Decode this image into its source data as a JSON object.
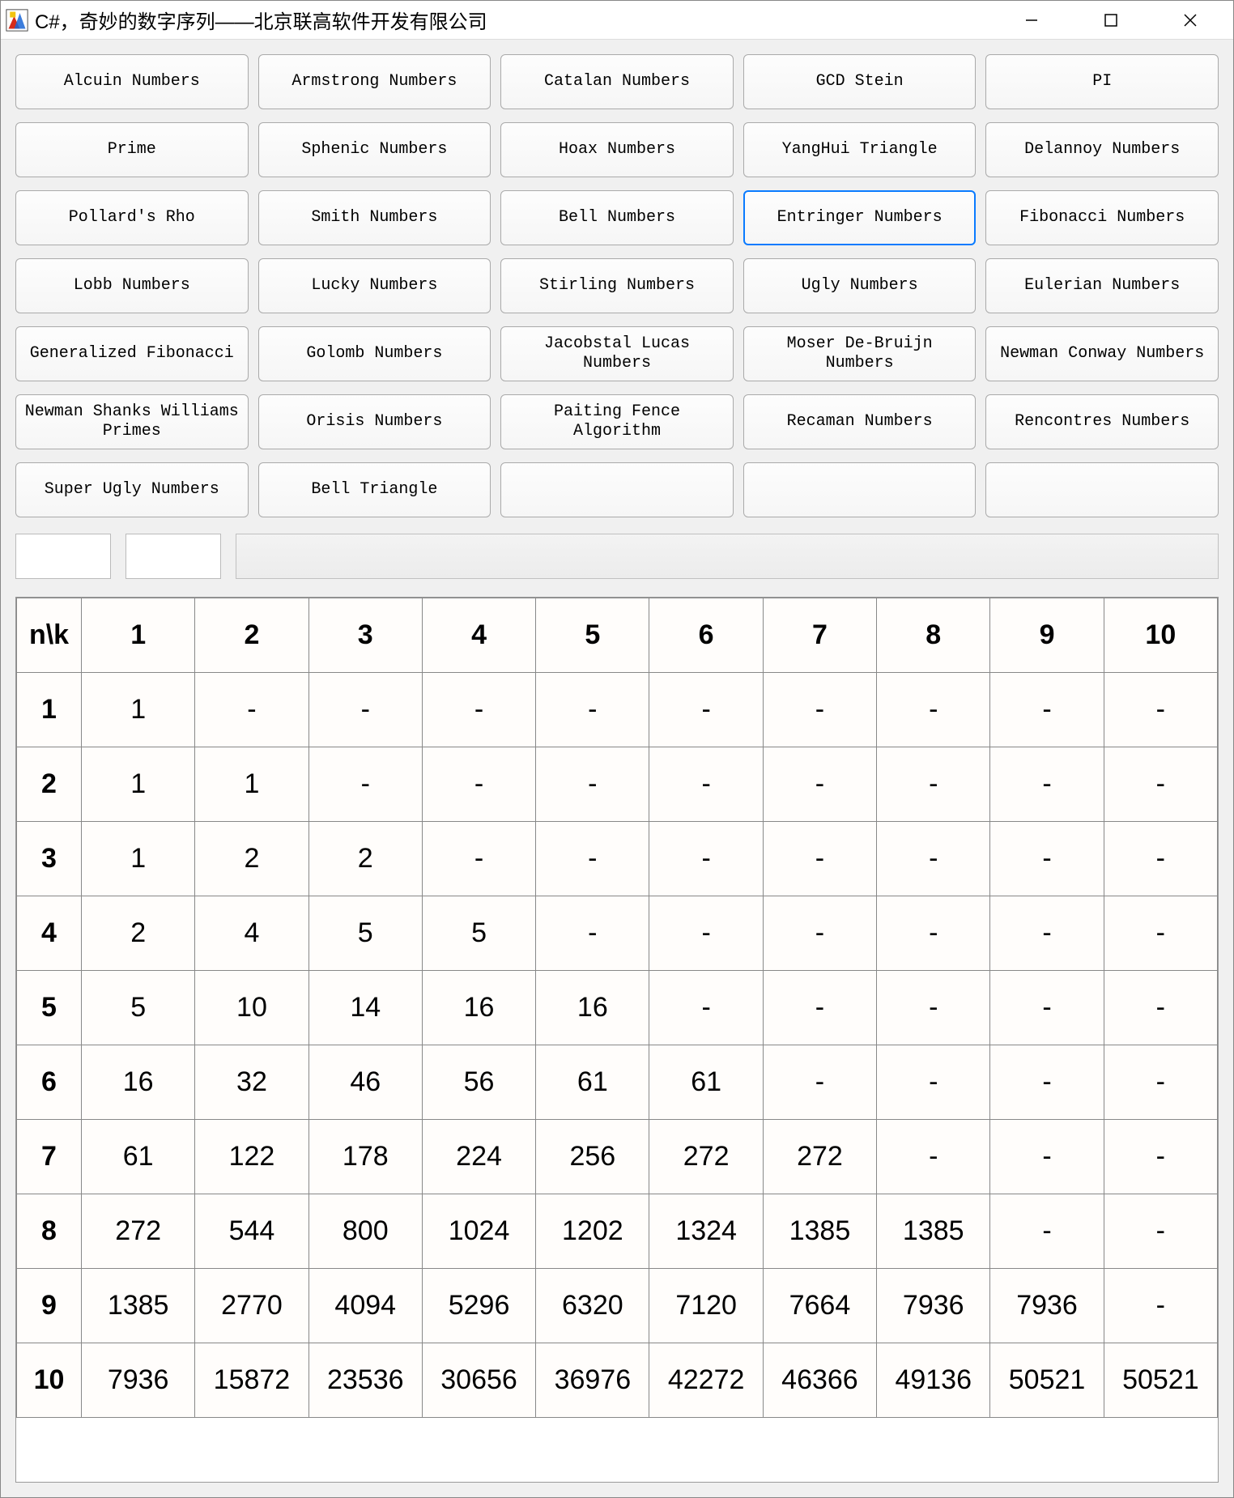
{
  "window": {
    "title": "C#，奇妙的数字序列——北京联高软件开发有限公司"
  },
  "buttons": [
    {
      "label": "Alcuin Numbers",
      "highlight": false
    },
    {
      "label": "Armstrong Numbers",
      "highlight": false
    },
    {
      "label": "Catalan Numbers",
      "highlight": false
    },
    {
      "label": "GCD Stein",
      "highlight": false
    },
    {
      "label": "PI",
      "highlight": false
    },
    {
      "label": "Prime",
      "highlight": false
    },
    {
      "label": "Sphenic Numbers",
      "highlight": false
    },
    {
      "label": "Hoax Numbers",
      "highlight": false
    },
    {
      "label": "YangHui Triangle",
      "highlight": false
    },
    {
      "label": "Delannoy Numbers",
      "highlight": false
    },
    {
      "label": "Pollard's Rho",
      "highlight": false
    },
    {
      "label": "Smith Numbers",
      "highlight": false
    },
    {
      "label": "Bell Numbers",
      "highlight": false
    },
    {
      "label": "Entringer Numbers",
      "highlight": true
    },
    {
      "label": "Fibonacci Numbers",
      "highlight": false
    },
    {
      "label": "Lobb Numbers",
      "highlight": false
    },
    {
      "label": "Lucky Numbers",
      "highlight": false
    },
    {
      "label": "Stirling Numbers",
      "highlight": false
    },
    {
      "label": "Ugly Numbers",
      "highlight": false
    },
    {
      "label": "Eulerian Numbers",
      "highlight": false
    },
    {
      "label": "Generalized Fibonacci",
      "highlight": false
    },
    {
      "label": "Golomb Numbers",
      "highlight": false
    },
    {
      "label": "Jacobstal Lucas Numbers",
      "highlight": false
    },
    {
      "label": "Moser De-Bruijn Numbers",
      "highlight": false
    },
    {
      "label": "Newman Conway Numbers",
      "highlight": false
    },
    {
      "label": "Newman Shanks Williams Primes",
      "highlight": false
    },
    {
      "label": "Orisis Numbers",
      "highlight": false
    },
    {
      "label": "Paiting Fence Algorithm",
      "highlight": false
    },
    {
      "label": "Recaman Numbers",
      "highlight": false
    },
    {
      "label": "Rencontres Numbers",
      "highlight": false
    },
    {
      "label": "Super Ugly Numbers",
      "highlight": false
    },
    {
      "label": "Bell Triangle",
      "highlight": false
    },
    {
      "label": "",
      "highlight": false
    },
    {
      "label": "",
      "highlight": false
    },
    {
      "label": "",
      "highlight": false
    }
  ],
  "chart_data": {
    "type": "table",
    "corner": "n\\k",
    "columns": [
      "1",
      "2",
      "3",
      "4",
      "5",
      "6",
      "7",
      "8",
      "9",
      "10"
    ],
    "rows": [
      {
        "n": "1",
        "cells": [
          "1",
          "-",
          "-",
          "-",
          "-",
          "-",
          "-",
          "-",
          "-",
          "-"
        ]
      },
      {
        "n": "2",
        "cells": [
          "1",
          "1",
          "-",
          "-",
          "-",
          "-",
          "-",
          "-",
          "-",
          "-"
        ]
      },
      {
        "n": "3",
        "cells": [
          "1",
          "2",
          "2",
          "-",
          "-",
          "-",
          "-",
          "-",
          "-",
          "-"
        ]
      },
      {
        "n": "4",
        "cells": [
          "2",
          "4",
          "5",
          "5",
          "-",
          "-",
          "-",
          "-",
          "-",
          "-"
        ]
      },
      {
        "n": "5",
        "cells": [
          "5",
          "10",
          "14",
          "16",
          "16",
          "-",
          "-",
          "-",
          "-",
          "-"
        ]
      },
      {
        "n": "6",
        "cells": [
          "16",
          "32",
          "46",
          "56",
          "61",
          "61",
          "-",
          "-",
          "-",
          "-"
        ]
      },
      {
        "n": "7",
        "cells": [
          "61",
          "122",
          "178",
          "224",
          "256",
          "272",
          "272",
          "-",
          "-",
          "-"
        ]
      },
      {
        "n": "8",
        "cells": [
          "272",
          "544",
          "800",
          "1024",
          "1202",
          "1324",
          "1385",
          "1385",
          "-",
          "-"
        ]
      },
      {
        "n": "9",
        "cells": [
          "1385",
          "2770",
          "4094",
          "5296",
          "6320",
          "7120",
          "7664",
          "7936",
          "7936",
          "-"
        ]
      },
      {
        "n": "10",
        "cells": [
          "7936",
          "15872",
          "23536",
          "30656",
          "36976",
          "42272",
          "46366",
          "49136",
          "50521",
          "50521"
        ]
      }
    ]
  }
}
